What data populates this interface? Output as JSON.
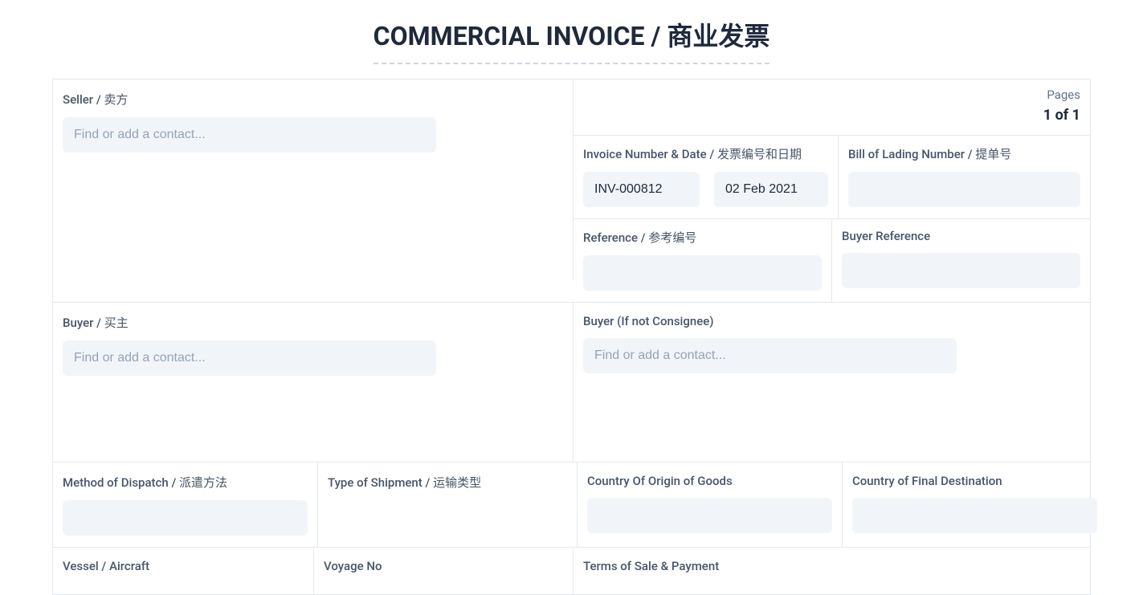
{
  "header": {
    "title": "COMMERCIAL INVOICE / 商业发票"
  },
  "pages": {
    "label": "Pages",
    "value": "1 of 1"
  },
  "fields": {
    "seller": {
      "label": "Seller / 卖方",
      "placeholder": "Find or add a contact...",
      "value": ""
    },
    "invoice_number_date": {
      "label": "Invoice Number & Date /  发票编号和日期",
      "number_value": "INV-000812",
      "date_value": "02 Feb 2021"
    },
    "bill_of_lading": {
      "label": "Bill of Lading Number / 提单号",
      "value": ""
    },
    "reference": {
      "label": "Reference / 参考编号",
      "value": ""
    },
    "buyer_reference": {
      "label": "Buyer Reference",
      "value": ""
    },
    "buyer": {
      "label": "Buyer / 买主",
      "placeholder": "Find or add a contact...",
      "value": ""
    },
    "buyer_not_consignee": {
      "label": "Buyer (If not Consignee)",
      "placeholder": "Find or add a contact...",
      "value": ""
    },
    "method_of_dispatch": {
      "label": "Method of Dispatch / 派遣方法",
      "value": ""
    },
    "type_of_shipment": {
      "label": "Type of Shipment / 运输类型",
      "value": ""
    },
    "country_origin": {
      "label": "Country Of Origin of Goods",
      "value": ""
    },
    "country_final": {
      "label": "Country of Final Destination",
      "value": ""
    },
    "vessel_aircraft": {
      "label": "Vessel / Aircraft"
    },
    "voyage_no": {
      "label": "Voyage No"
    },
    "terms_sale_payment": {
      "label": "Terms of Sale & Payment"
    }
  }
}
